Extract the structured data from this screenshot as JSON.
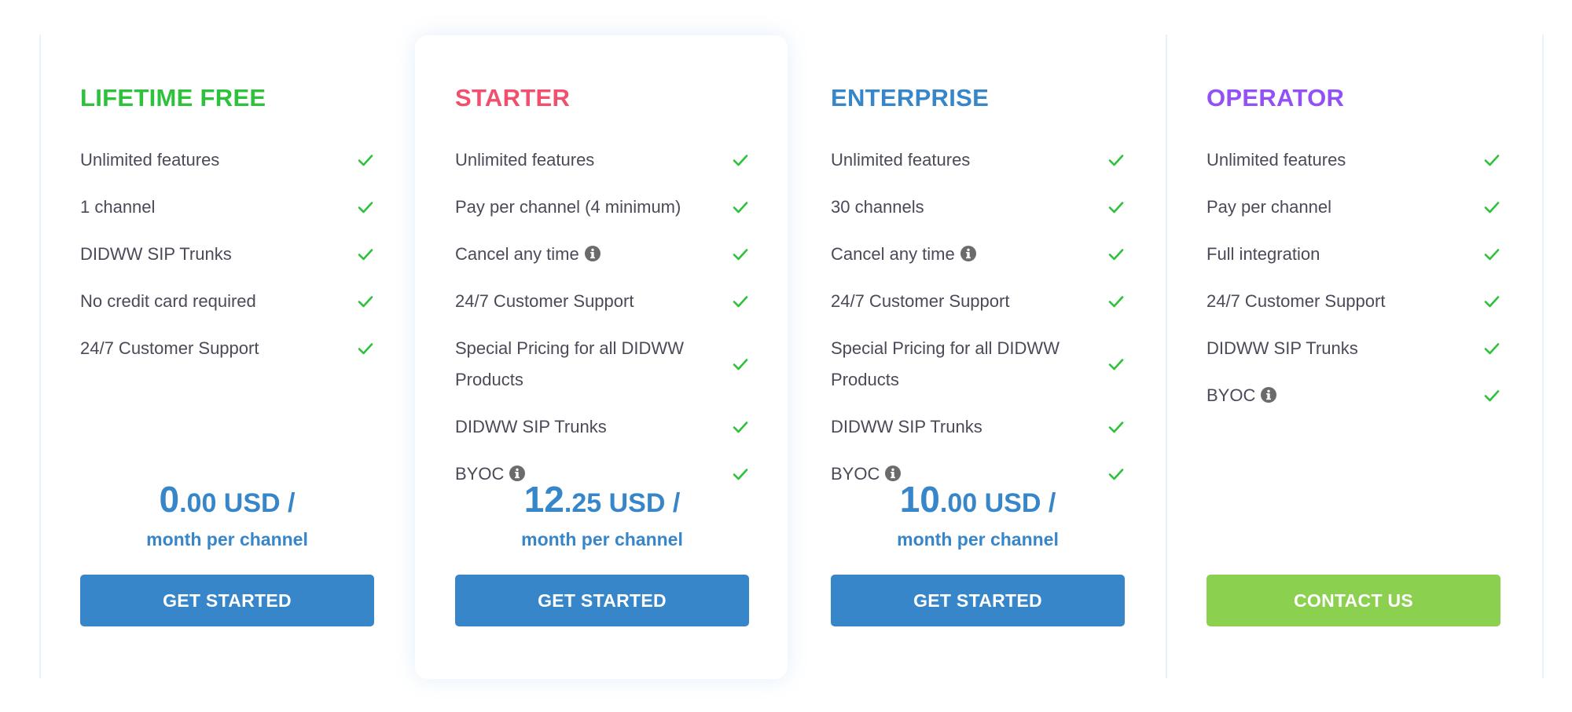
{
  "colors": {
    "free": "#2ec13c",
    "starter": "#f0506e",
    "enterprise": "#3686c9",
    "operator": "#9250f5",
    "check": "#2ec13c",
    "button_primary": "#3686c9",
    "button_contact": "#8bd04f",
    "text": "#4a4a58",
    "info_icon": "#6b6b6b"
  },
  "plans": [
    {
      "title": "LIFETIME FREE",
      "features": [
        {
          "text": "Unlimited features",
          "info": false
        },
        {
          "text": "1 channel",
          "info": false
        },
        {
          "text": "DIDWW SIP Trunks",
          "info": false
        },
        {
          "text": "No credit card required",
          "info": false
        },
        {
          "text": "24/7 Customer Support",
          "info": false
        }
      ],
      "price": {
        "int": "0",
        "dec": ".00",
        "currency": " USD /",
        "period": "month per channel"
      },
      "button": "GET STARTED"
    },
    {
      "title": "STARTER",
      "features": [
        {
          "text": "Unlimited features",
          "info": false
        },
        {
          "text": "Pay per channel (4 minimum)",
          "info": false
        },
        {
          "text": "Cancel any time",
          "info": true
        },
        {
          "text": "24/7 Customer Support",
          "info": false
        },
        {
          "text": "Special Pricing for all DIDWW Products",
          "info": false
        },
        {
          "text": "DIDWW SIP Trunks",
          "info": false
        },
        {
          "text": "BYOC",
          "info": true
        }
      ],
      "price": {
        "int": "12",
        "dec": ".25",
        "currency": " USD /",
        "period": "month per channel"
      },
      "button": "GET STARTED"
    },
    {
      "title": "ENTERPRISE",
      "features": [
        {
          "text": "Unlimited features",
          "info": false
        },
        {
          "text": "30 channels",
          "info": false
        },
        {
          "text": "Cancel any time",
          "info": true
        },
        {
          "text": "24/7 Customer Support",
          "info": false
        },
        {
          "text": "Special Pricing for all DIDWW Products",
          "info": false
        },
        {
          "text": "DIDWW SIP Trunks",
          "info": false
        },
        {
          "text": "BYOC",
          "info": true
        }
      ],
      "price": {
        "int": "10",
        "dec": ".00",
        "currency": " USD /",
        "period": "month per channel"
      },
      "button": "GET STARTED"
    },
    {
      "title": "OPERATOR",
      "features": [
        {
          "text": "Unlimited features",
          "info": false
        },
        {
          "text": "Pay per channel",
          "info": false
        },
        {
          "text": "Full integration",
          "info": false
        },
        {
          "text": "24/7 Customer Support",
          "info": false
        },
        {
          "text": "DIDWW SIP Trunks",
          "info": false
        },
        {
          "text": "BYOC",
          "info": true
        }
      ],
      "button": "CONTACT US"
    }
  ]
}
